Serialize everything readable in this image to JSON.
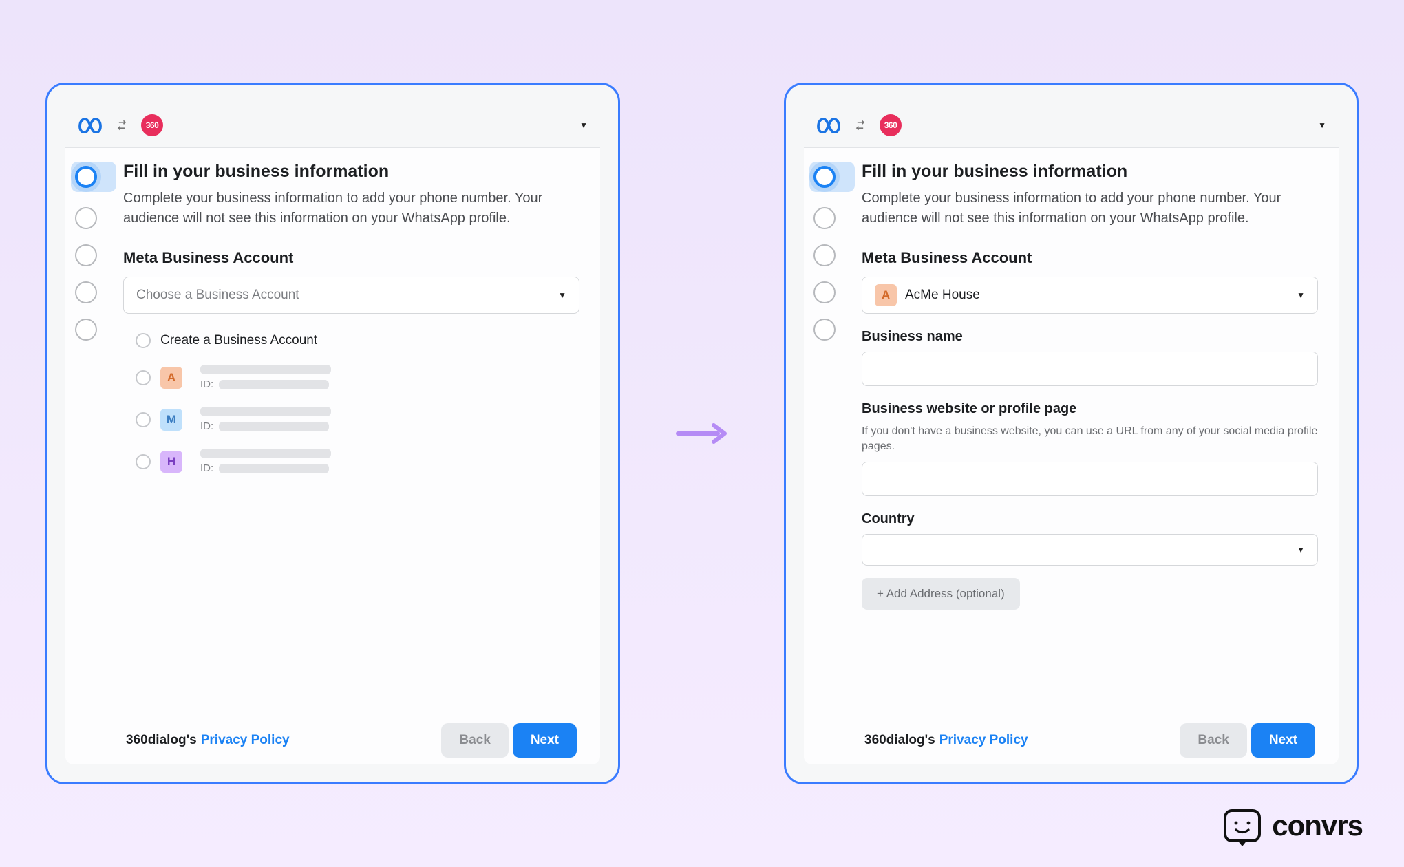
{
  "common": {
    "title": "Fill in your business information",
    "subtitle": "Complete your business information to add your phone number. Your audience will not see this information on your WhatsApp profile.",
    "meta_label": "Meta Business Account",
    "footer_prefix": "360dialog's ",
    "privacy_link": "Privacy Policy",
    "back": "Back",
    "next": "Next",
    "badge_360": "360"
  },
  "left": {
    "select_placeholder": "Choose a Business Account",
    "create_label": "Create a Business Account",
    "accounts": [
      {
        "letter": "A",
        "id_label": "ID:"
      },
      {
        "letter": "M",
        "id_label": "ID:"
      },
      {
        "letter": "H",
        "id_label": "ID:"
      }
    ]
  },
  "right": {
    "selected_account": {
      "letter": "A",
      "name": "AcMe House"
    },
    "business_name_label": "Business name",
    "website_label": "Business website or profile page",
    "website_helper": "If you don't have a business website, you can use a URL from any of your social media profile pages.",
    "country_label": "Country",
    "add_address": "+ Add Address (optional)"
  },
  "brand": {
    "name": "convrs"
  }
}
